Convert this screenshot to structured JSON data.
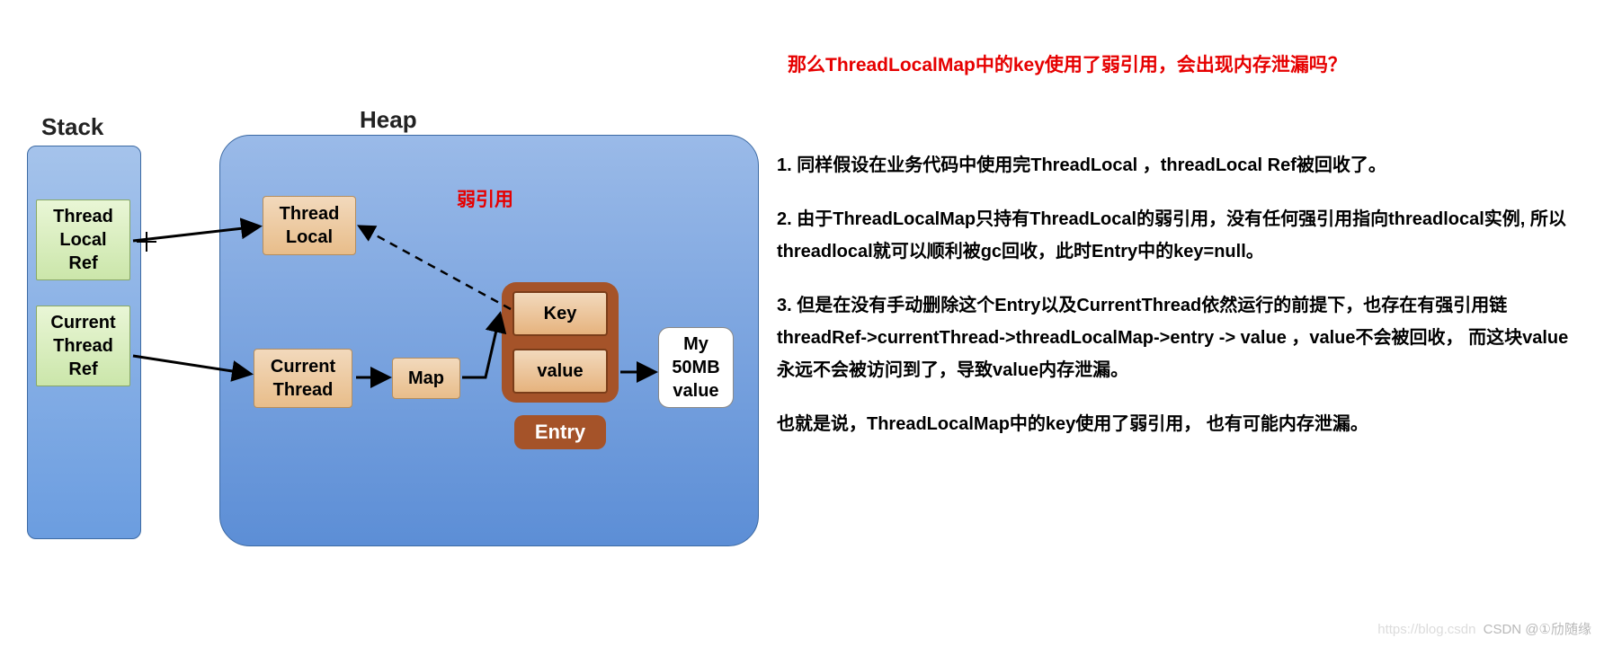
{
  "title": "那么ThreadLocalMap中的key使用了弱引用，会出现内存泄漏吗？",
  "labels": {
    "stack": "Stack",
    "heap": "Heap",
    "weak_ref": "弱引用"
  },
  "stack": {
    "thread_local_ref": "Thread\nLocal\nRef",
    "current_thread_ref": "Current\nThread\nRef"
  },
  "heap": {
    "thread_local": "Thread\nLocal",
    "current_thread": "Current\nThread",
    "map": "Map",
    "entry_key": "Key",
    "entry_value": "value",
    "entry_label": "Entry",
    "my_value": "My\n50MB\nvalue"
  },
  "paragraphs": {
    "p1": "1. 同样假设在业务代码中使用完ThreadLocal ，threadLocal Ref被回收了。",
    "p2": "2. 由于ThreadLocalMap只持有ThreadLocal的弱引用，没有任何强引用指向threadlocal实例, 所以threadlocal就可以顺利被gc回收，此时Entry中的key=null。",
    "p3": "3. 但是在没有手动删除这个Entry以及CurrentThread依然运行的前提下，也存在有强引用链 threadRef->currentThread->threadLocalMap->entry -> value ，value不会被回收， 而这块value永远不会被访问到了，导致value内存泄漏。",
    "p4": "也就是说，ThreadLocalMap中的key使用了弱引用， 也有可能内存泄漏。"
  },
  "watermark": {
    "faint": "https://blog.csdn",
    "main": "CSDN @①劤随缘"
  }
}
